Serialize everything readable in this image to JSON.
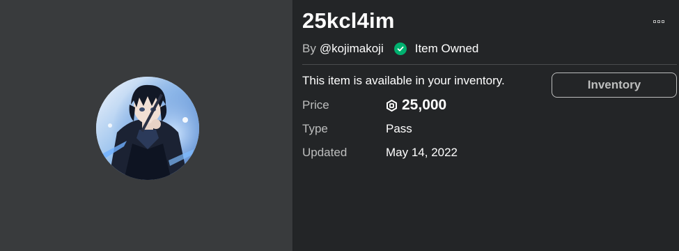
{
  "item": {
    "title": "25kcl4im",
    "by_prefix": "By",
    "creator": "@kojimakoji",
    "owned_label": "Item Owned",
    "availability_text": "This item is available in your inventory.",
    "inventory_button_label": "Inventory"
  },
  "fields": {
    "price_label": "Price",
    "price_value": "25,000",
    "type_label": "Type",
    "type_value": "Pass",
    "updated_label": "Updated",
    "updated_value": "May 14, 2022"
  },
  "icons": {
    "owned": "check-circle-icon",
    "currency": "robux-icon",
    "more": "more-options-icon"
  },
  "colors": {
    "background": "#232527",
    "thumbnail_panel": "#393b3d",
    "owned_green": "#00b06f",
    "muted_text": "#bdbebe",
    "text": "#ffffff"
  }
}
